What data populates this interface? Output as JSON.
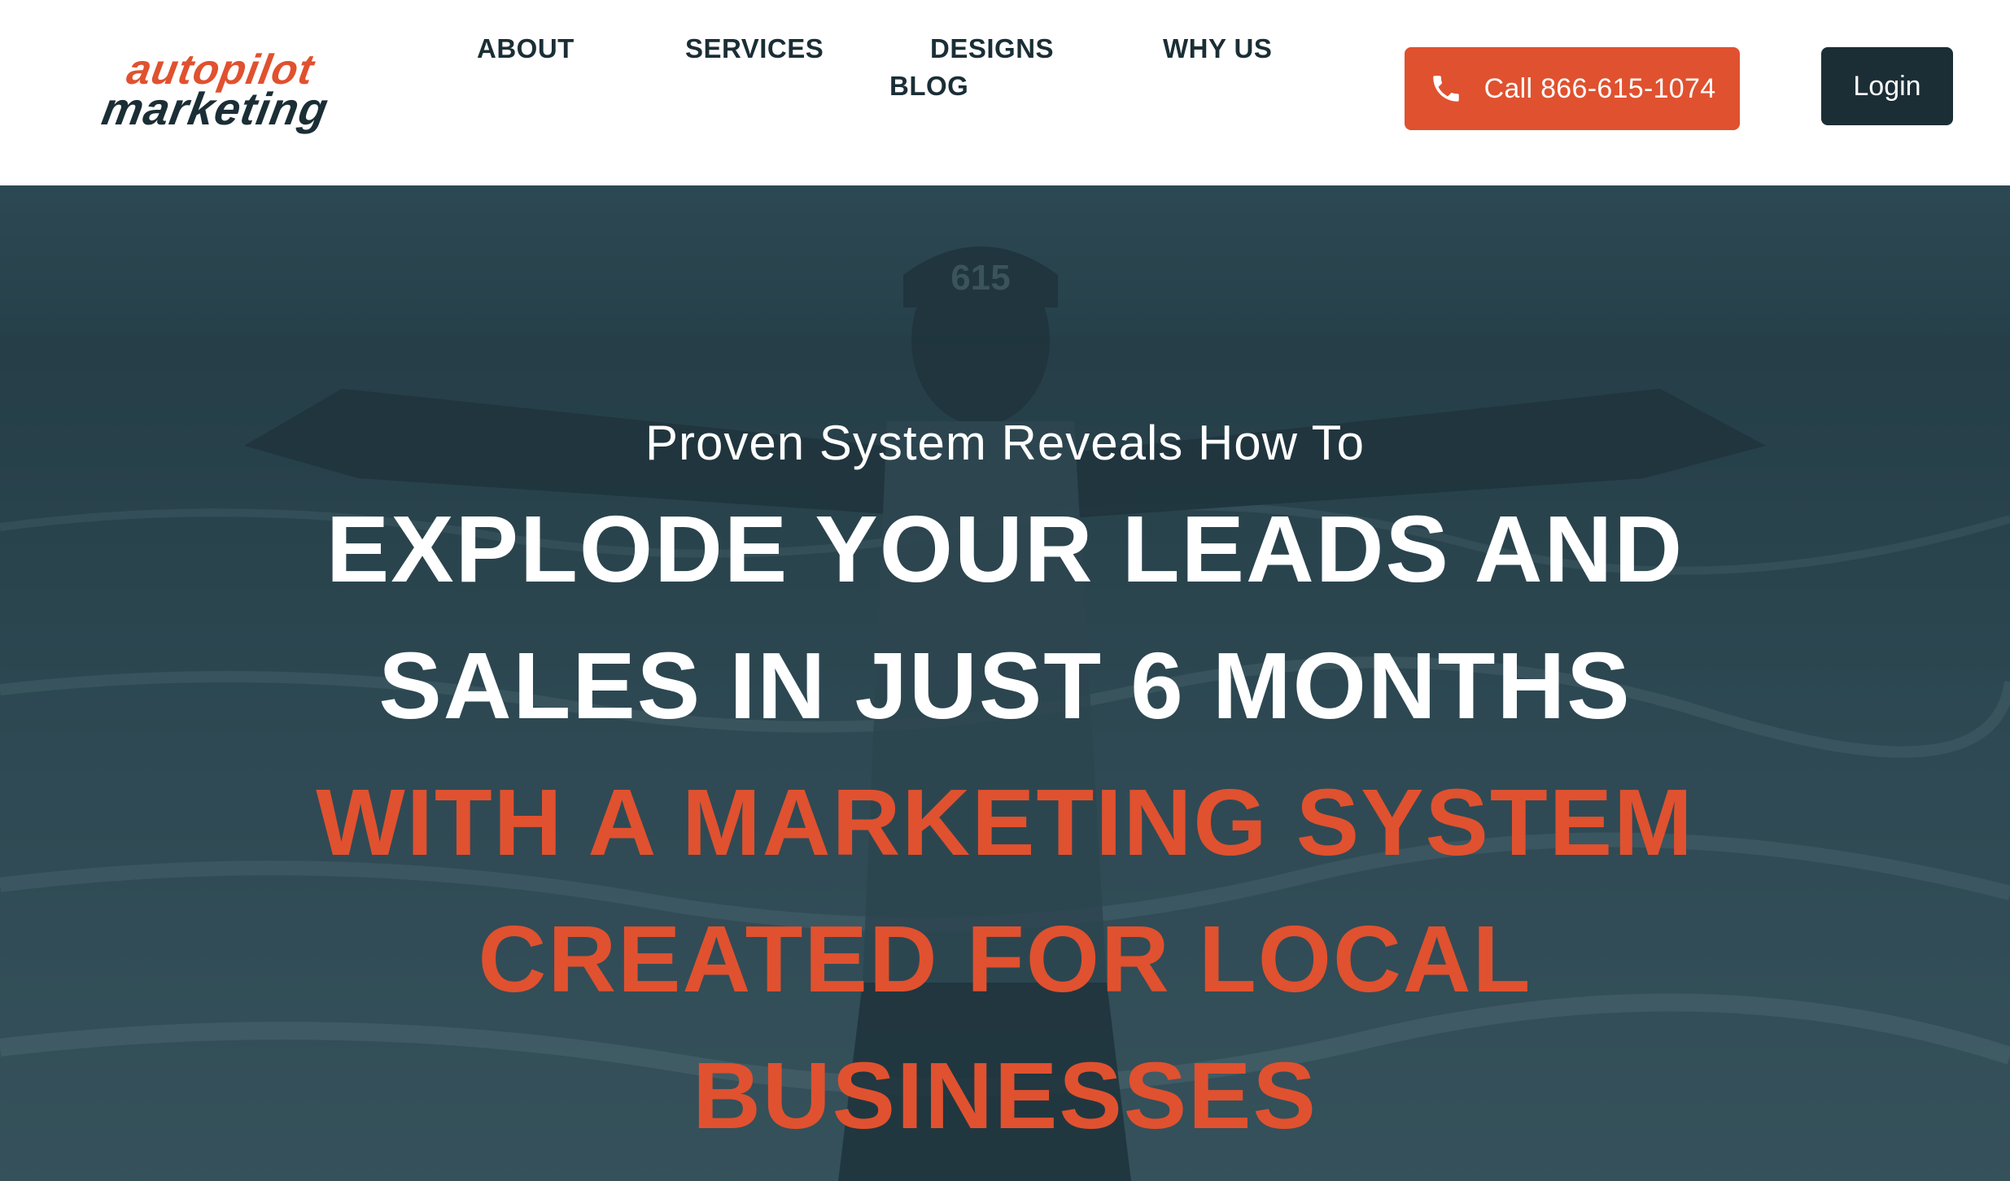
{
  "brand": {
    "logo_top": "autopilot",
    "logo_bottom": "marketing",
    "accent_color": "#e0512f",
    "dark_color": "#1b2e36"
  },
  "nav": {
    "items": [
      {
        "label": "ABOUT"
      },
      {
        "label": "SERVICES"
      },
      {
        "label": "DESIGNS"
      },
      {
        "label": "WHY US"
      },
      {
        "label": "BLOG"
      }
    ]
  },
  "header_actions": {
    "call_label": "Call 866-615-1074",
    "call_icon": "phone-icon",
    "login_label": "Login"
  },
  "hero": {
    "kicker": "Proven System Reveals How To",
    "headline_lines": [
      "EXPLODE YOUR LEADS AND",
      "SALES IN JUST 6 MONTHS"
    ],
    "highlight_lines": [
      "WITH A MARKETING SYSTEM",
      "CREATED FOR LOCAL",
      "BUSINESSES"
    ],
    "cap_text": "615"
  }
}
